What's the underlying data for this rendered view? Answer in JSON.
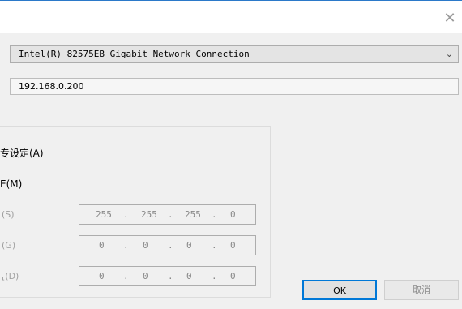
{
  "window": {
    "close_glyph": "✕"
  },
  "adapter": {
    "value": "Intel(R) 82575EB Gigabit Network Connection",
    "chevron": "⌄"
  },
  "ip_field": {
    "value": "192.168.0.200"
  },
  "options": {
    "auto_label": "专设定(A)",
    "manual_label": "E(M)"
  },
  "fields": [
    {
      "label": "(S)",
      "octets": [
        "255",
        "255",
        "255",
        "0"
      ]
    },
    {
      "label": "(G)",
      "octets": [
        "0",
        "0",
        "0",
        "0"
      ]
    },
    {
      "label": "⸤(D)",
      "octets": [
        "0",
        "0",
        "0",
        "0"
      ]
    }
  ],
  "buttons": {
    "ok": "OK",
    "cancel": "取消"
  },
  "colors": {
    "accent": "#0078d7",
    "titlebar_border": "#2b79c9"
  }
}
